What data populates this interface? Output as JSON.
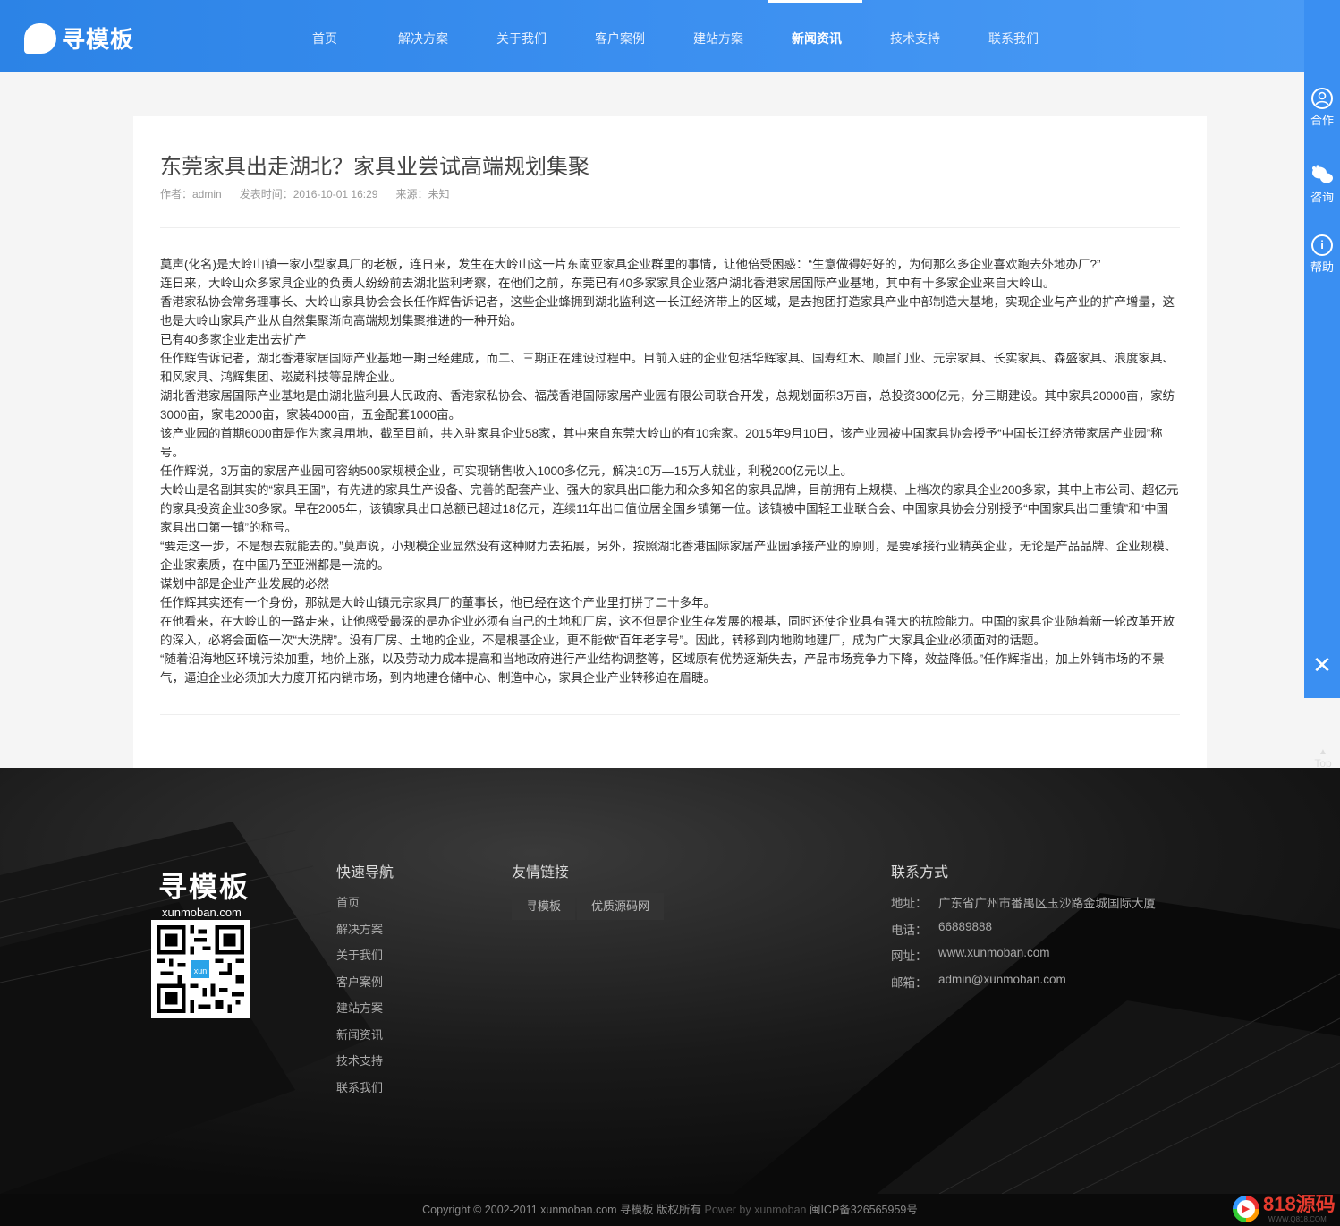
{
  "header": {
    "logo_text": "寻模板",
    "nav": [
      "首页",
      "解决方案",
      "关于我们",
      "客户案例",
      "建站方案",
      "新闻资讯",
      "技术支持",
      "联系我们"
    ],
    "active_index": 5
  },
  "sidebar": {
    "items": [
      {
        "label": "合作",
        "icon": "user-icon"
      },
      {
        "label": "咨询",
        "icon": "chat-icon"
      },
      {
        "label": "帮助",
        "icon": "info-icon"
      }
    ],
    "close": "✕",
    "top_label": "Top"
  },
  "article": {
    "title": "东莞家具出走湖北？家具业尝试高端规划集聚",
    "author": "作者：admin",
    "date": "发表时间：2016-10-01 16:29",
    "source": "来源：未知",
    "paragraphs": [
      "莫声(化名)是大岭山镇一家小型家具厂的老板，连日来，发生在大岭山这一片东南亚家具企业群里的事情，让他倍受困惑：“生意做得好好的，为何那么多企业喜欢跑去外地办厂?”",
      "连日来，大岭山众多家具企业的负责人纷纷前去湖北监利考察，在他们之前，东莞已有40多家家具企业落户湖北香港家居国际产业基地，其中有十多家企业来自大岭山。",
      "香港家私协会常务理事长、大岭山家具协会会长任作辉告诉记者，这些企业蜂拥到湖北监利这一长江经济带上的区域，是去抱团打造家具产业中部制造大基地，实现企业与产业的扩产增量，这也是大岭山家具产业从自然集聚渐向高端规划集聚推进的一种开始。",
      "已有40多家企业走出去扩产",
      "任作辉告诉记者，湖北香港家居国际产业基地一期已经建成，而二、三期正在建设过程中。目前入驻的企业包括华辉家具、国寿红木、顺昌门业、元宗家具、长实家具、森盛家具、浪度家具、和风家具、鸿辉集团、崧崴科技等品牌企业。",
      "湖北香港家居国际产业基地是由湖北监利县人民政府、香港家私协会、福茂香港国际家居产业园有限公司联合开发，总规划面积3万亩，总投资300亿元，分三期建设。其中家具20000亩，家纺3000亩，家电2000亩，家装4000亩，五金配套1000亩。",
      "该产业园的首期6000亩是作为家具用地，截至目前，共入驻家具企业58家，其中来自东莞大岭山的有10余家。2015年9月10日，该产业园被中国家具协会授予“中国长江经济带家居产业园”称号。",
      "任作辉说，3万亩的家居产业园可容纳500家规模企业，可实现销售收入1000多亿元，解决10万—15万人就业，利税200亿元以上。",
      "大岭山是名副其实的“家具王国”，有先进的家具生产设备、完善的配套产业、强大的家具出口能力和众多知名的家具品牌，目前拥有上规模、上档次的家具企业200多家，其中上市公司、超亿元的家具投资企业30多家。早在2005年，该镇家具出口总额已超过18亿元，连续11年出口值位居全国乡镇第一位。该镇被中国轻工业联合会、中国家具协会分别授予“中国家具出口重镇”和“中国家具出口第一镇”的称号。",
      "“要走这一步，不是想去就能去的。”莫声说，小规模企业显然没有这种财力去拓展，另外，按照湖北香港国际家居产业园承接产业的原则，是要承接行业精英企业，无论是产品品牌、企业规模、企业家素质，在中国乃至亚洲都是一流的。",
      "谋划中部是企业产业发展的必然",
      "任作辉其实还有一个身份，那就是大岭山镇元宗家具厂的董事长，他已经在这个产业里打拼了二十多年。",
      "在他看来，在大岭山的一路走来，让他感受最深的是办企业必须有自己的土地和厂房，这不但是企业生存发展的根基，同时还使企业具有强大的抗险能力。中国的家具企业随着新一轮改革开放的深入，必将会面临一次“大洗牌”。没有厂房、土地的企业，不是根基企业，更不能做“百年老字号”。因此，转移到内地购地建厂，成为广大家具企业必须面对的话题。",
      "“随着沿海地区环境污染加重，地价上涨，以及劳动力成本提高和当地政府进行产业结构调整等，区域原有优势逐渐失去，产品市场竞争力下降，效益降低。”任作辉指出，加上外销市场的不景气，逼迫企业必须加大力度开拓内销市场，到内地建仓储中心、制造中心，家具企业产业转移迫在眉睫。"
    ]
  },
  "footer": {
    "logo_main": "寻模板",
    "logo_sub": "xunmoban.com",
    "qr_center": "xun",
    "quick_nav_title": "快速导航",
    "quick_nav": [
      "首页",
      "解决方案",
      "关于我们",
      "客户案例",
      "建站方案",
      "新闻资讯",
      "技术支持",
      "联系我们"
    ],
    "links_title": "友情链接",
    "links": [
      "寻模板",
      "优质源码网"
    ],
    "contact_title": "联系方式",
    "contact": [
      {
        "label": "地址：",
        "value": "广东省广州市番禺区玉沙路金城国际大厦"
      },
      {
        "label": "电话：",
        "value": "66889888"
      },
      {
        "label": "网址：",
        "value": "www.xunmoban.com"
      },
      {
        "label": "邮箱：",
        "value": "admin@xunmoban.com"
      }
    ],
    "copyright": "Copyright © 2002-2011 xunmoban.com 寻模板 版权所有",
    "power": "Power by xunmoban",
    "icp": "闽ICP备326565959号"
  },
  "badge": {
    "text": "818源码",
    "sub": "WWW.Q818.COM"
  }
}
